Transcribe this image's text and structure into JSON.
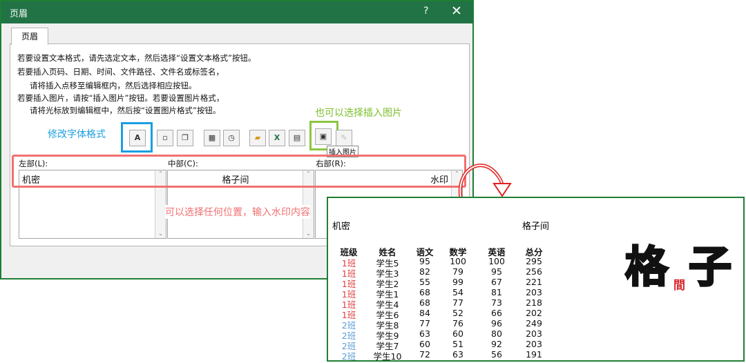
{
  "dialog": {
    "title": "页眉",
    "help_glyph": "?",
    "close_glyph": "✕",
    "tab_label": "页眉",
    "instructions": [
      "若要设置文本格式，请先选定文本，然后选择“设置文本格式”按钮。",
      "若要插入页码、日期、时间、文件路径、文件名或标签名，",
      "请将插入点移至编辑框内，然后选择相应按钮。",
      "若要插入图片，请按“插入图片”按钮。若要设置图片格式，",
      "请将光标放到编辑框中，然后按“设置图片格式”按钮。"
    ],
    "format_text_button": "A",
    "tooltip": "插入图片",
    "left_label": "左部(L):",
    "center_label": "中部(C):",
    "right_label": "右部(R):",
    "left_value": "机密",
    "center_value": "格子间",
    "right_value": "水印",
    "scroll_up": "⌃",
    "scroll_down": "⌄"
  },
  "annotations": {
    "format_font": "修改字体格式",
    "insert_picture": "也可以选择插入图片",
    "position_hint": "可以选择任何位置，输入水印内容"
  },
  "colors": {
    "excel_green": "#217346",
    "blue_highlight": "#1b9ee0",
    "green_highlight": "#8cc63f",
    "red_highlight": "#f07070",
    "class1_red": "#e03c3c",
    "class2_blue": "#5b9bd5"
  },
  "preview": {
    "left_header": "机密",
    "center_header": "格子间",
    "watermark_big1": "格",
    "watermark_small": "間",
    "watermark_big2": "子",
    "columns": [
      "班级",
      "姓名",
      "语文",
      "数学",
      "英语",
      "总分"
    ],
    "rows": [
      [
        "1班",
        "学生5",
        "95",
        "100",
        "100",
        "295"
      ],
      [
        "1班",
        "学生3",
        "82",
        "79",
        "95",
        "256"
      ],
      [
        "1班",
        "学生2",
        "55",
        "99",
        "67",
        "221"
      ],
      [
        "1班",
        "学生1",
        "68",
        "54",
        "81",
        "203"
      ],
      [
        "1班",
        "学生4",
        "68",
        "77",
        "73",
        "218"
      ],
      [
        "1班",
        "学生6",
        "84",
        "52",
        "66",
        "202"
      ],
      [
        "2班",
        "学生8",
        "77",
        "76",
        "96",
        "249"
      ],
      [
        "2班",
        "学生9",
        "63",
        "60",
        "80",
        "203"
      ],
      [
        "2班",
        "学生7",
        "60",
        "51",
        "92",
        "203"
      ],
      [
        "2班",
        "学生10",
        "72",
        "63",
        "56",
        "191"
      ]
    ]
  }
}
